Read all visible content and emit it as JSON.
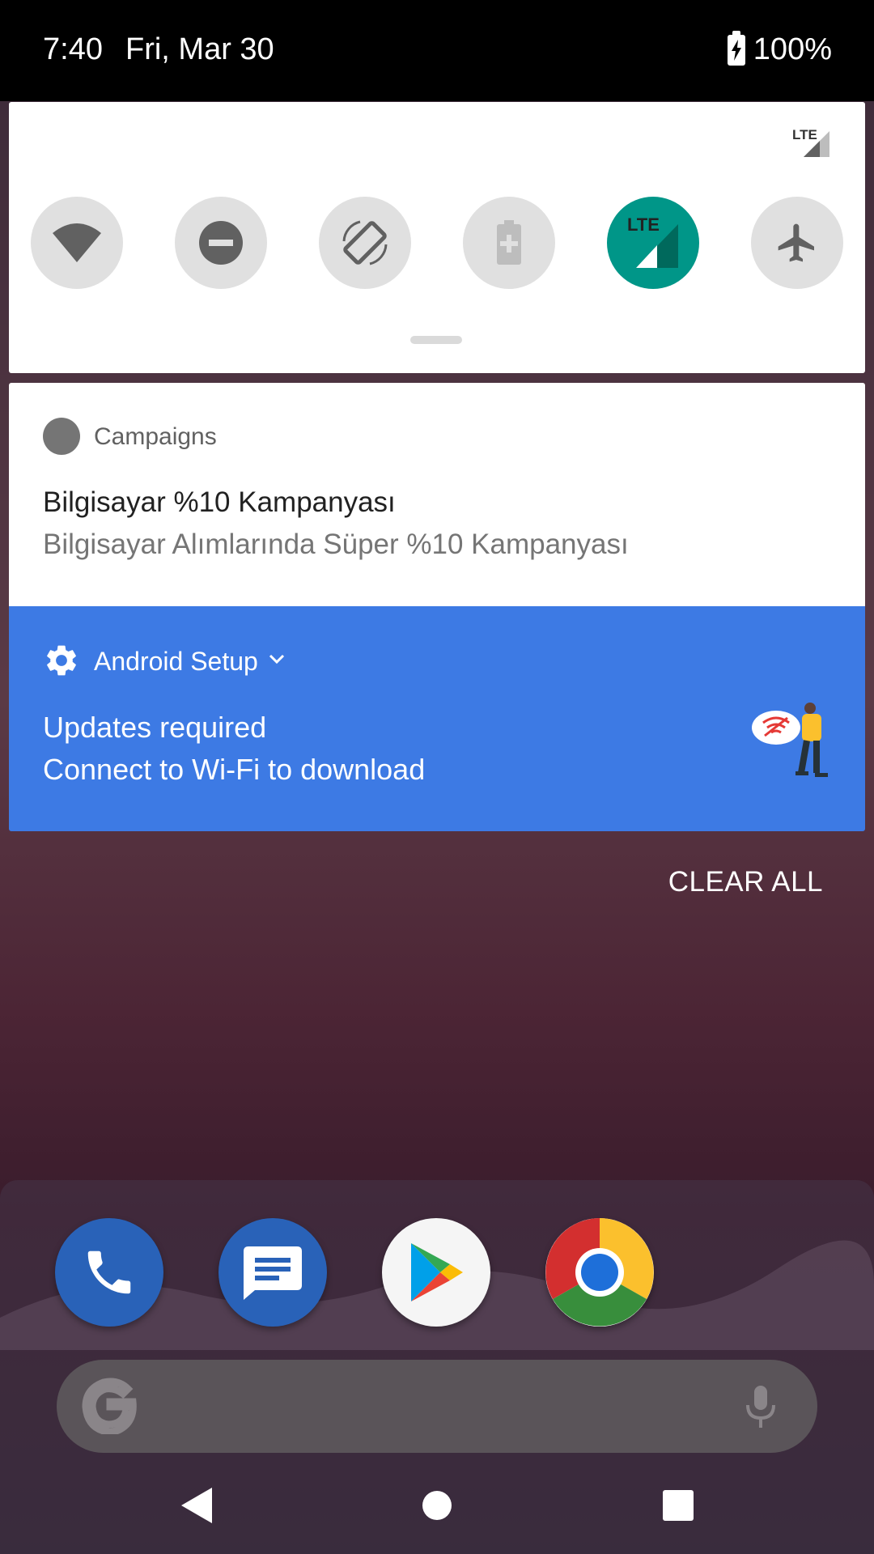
{
  "status_bar": {
    "time": "7:40",
    "date": "Fri, Mar 30",
    "battery": "100%"
  },
  "quick_settings": {
    "signal_label": "LTE",
    "tiles": [
      {
        "icon": "wifi-icon",
        "active": false
      },
      {
        "icon": "do-not-disturb-icon",
        "active": false
      },
      {
        "icon": "auto-rotate-icon",
        "active": false
      },
      {
        "icon": "battery-saver-icon",
        "active": false
      },
      {
        "icon": "mobile-data-icon",
        "label": "LTE",
        "active": true
      },
      {
        "icon": "airplane-mode-icon",
        "active": false
      }
    ],
    "active_color": "#009688"
  },
  "notifications": [
    {
      "app": "Campaigns",
      "title": "Bilgisayar %10 Kampanyası",
      "text": "Bilgisayar Alımlarında Süper %10 Kampanyası"
    },
    {
      "app": "Android Setup",
      "title": "Updates required",
      "text": "Connect to Wi-Fi to download",
      "color": "#3d7ae4"
    }
  ],
  "clear_all": "CLEAR ALL",
  "dock": {
    "apps": [
      "phone-icon",
      "messages-icon",
      "play-store-icon",
      "chrome-icon"
    ]
  },
  "nav": [
    "back-icon",
    "home-icon",
    "recents-icon"
  ]
}
